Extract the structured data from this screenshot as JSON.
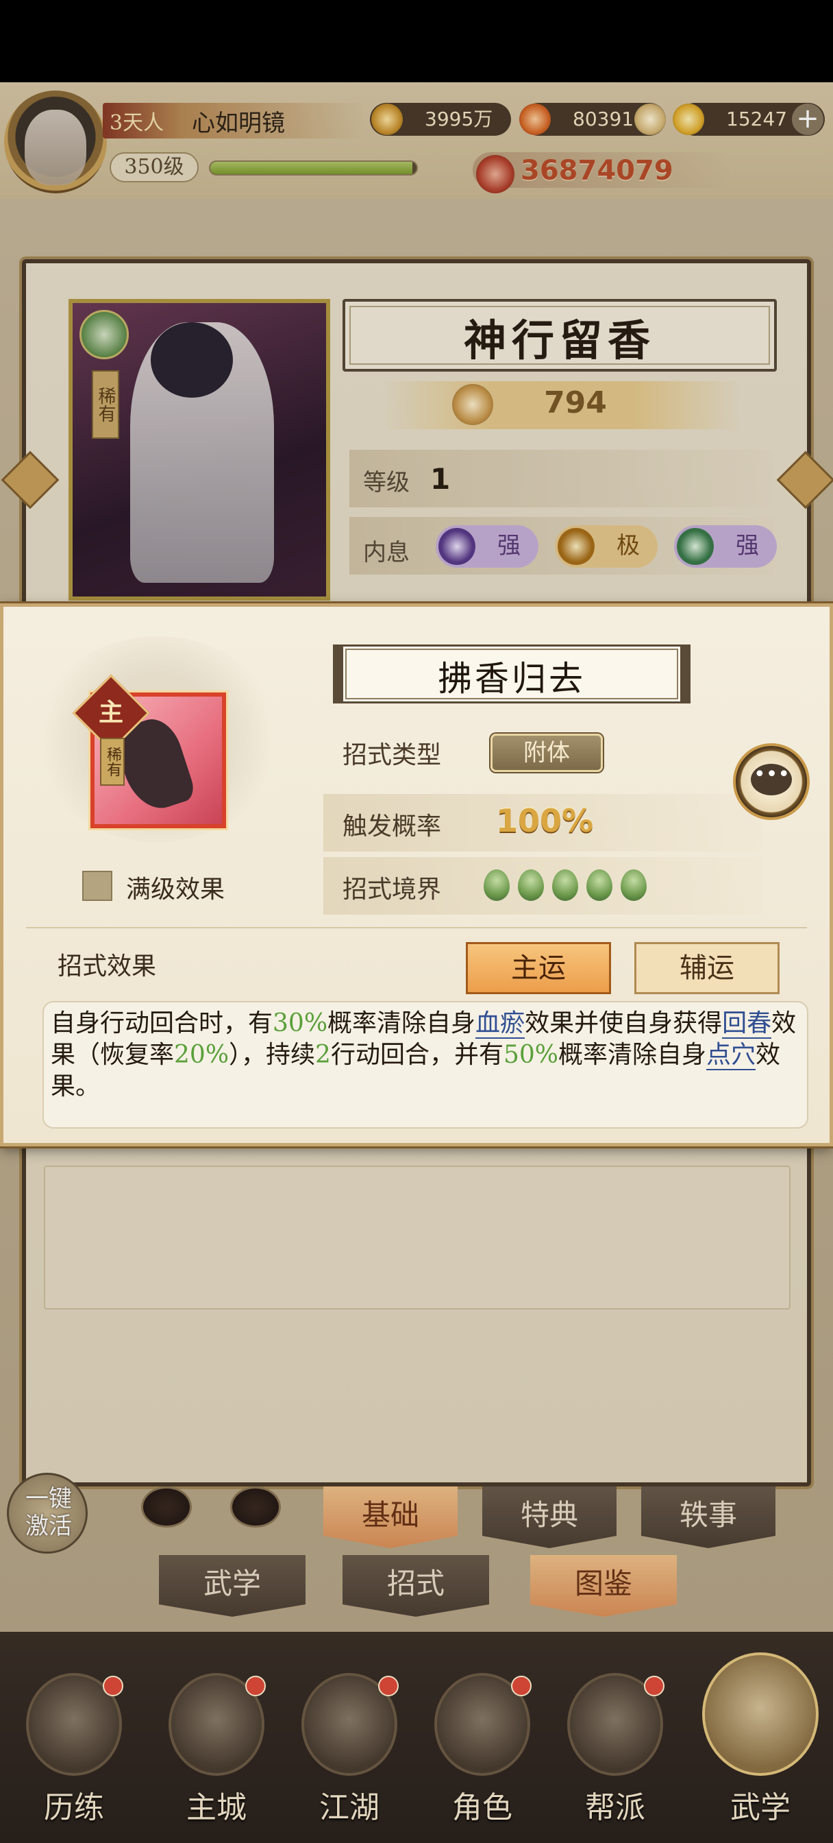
{
  "player": {
    "rank": "天人",
    "rank_level": "3",
    "name": "心如明镜",
    "level": "350级",
    "exp_progress": 0.98,
    "power": "36874079"
  },
  "resources": {
    "coins": "3995万",
    "flames": "80391",
    "gold": "15247"
  },
  "hero": {
    "rarity": "稀有",
    "name": "神行留香",
    "score": "794",
    "level_label": "等级",
    "level_value": "1",
    "neixi_label": "内息",
    "neixi": [
      "强",
      "极",
      "强"
    ]
  },
  "skill_modal": {
    "main_mark": "主",
    "rarity": "稀有",
    "name": "拂香归去",
    "max_effect_label": "满级效果",
    "type_label": "招式类型",
    "type_value": "附体",
    "rate_label": "触发概率",
    "rate_value": "100%",
    "realm_label": "招式境界",
    "realm_count": 5,
    "effect_label": "招式效果",
    "luck_main": "主运",
    "luck_aux": "辅运",
    "desc": {
      "p1": "自身行动回合时，有",
      "v1": "30%",
      "p2": "概率清除自身",
      "l1": "血瘀",
      "p3": "效果并使自身获得",
      "l2": "回春",
      "p4": "效果（恢复率",
      "v2": "20%",
      "p5": "），持续",
      "v3": "2",
      "p6": "行动回合，并有",
      "v4": "50%",
      "p7": "概率清除自身",
      "l3": "点穴",
      "p8": "效果。"
    }
  },
  "bottom": {
    "activate": "一键激活",
    "sub_tabs": [
      "基础",
      "特典",
      "轶事"
    ],
    "main_tabs": [
      "武学",
      "招式",
      "图鉴"
    ],
    "nav": [
      "历练",
      "主城",
      "江湖",
      "角色",
      "帮派",
      "武学"
    ]
  },
  "colors": {
    "accent_green": "#5aa03a",
    "link_blue": "#2f4e92",
    "tab_active": "#dc915a",
    "badge_red": "#e04a3a"
  }
}
